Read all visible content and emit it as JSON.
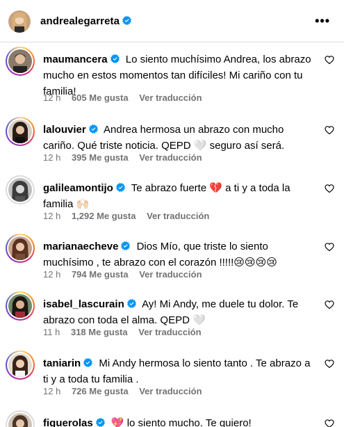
{
  "post": {
    "author": "andrealegarreta"
  },
  "comments": [
    {
      "user": "maumancera",
      "text": "Lo siento muchísimo Andrea, los abrazo mucho en estos momentos tan difíciles! Mi cariño con tu familia!",
      "time": "12 h",
      "likes": "605 Me gusta",
      "translate": "Ver traducción",
      "story_ring": true
    },
    {
      "user": "lalouvier",
      "text": "Andrea hermosa un abrazo con mucho cariño. Qué triste noticia. QEPD 🤍 seguro así será.",
      "time": "12 h",
      "likes": "395 Me gusta",
      "translate": "Ver traducción",
      "story_ring": true
    },
    {
      "user": "galileamontijo",
      "text": "Te abrazo fuerte 💔 a ti y a toda la familia 🙌🏻",
      "time": "12 h",
      "likes": "1,292 Me gusta",
      "translate": "Ver traducción",
      "story_ring": false
    },
    {
      "user": "marianaecheve",
      "text": "Dios Mío, que triste lo siento muchísimo , te abrazo con el corazón !!!!!😢😢😢😢",
      "time": "12 h",
      "likes": "794 Me gusta",
      "translate": "Ver traducción",
      "story_ring": true
    },
    {
      "user": "isabel_lascurain",
      "text": "Ay! Mi Andy, me duele tu dolor. Te abrazo con toda el alma. QEPD 🤍",
      "time": "11 h",
      "likes": "318 Me gusta",
      "translate": "Ver traducción",
      "story_ring": true
    },
    {
      "user": "taniarin",
      "text": "Mi Andy hermosa lo siento tanto . Te abrazo a ti y a toda tu familia .",
      "time": "12 h",
      "likes": "726 Me gusta",
      "translate": "Ver traducción",
      "story_ring": true
    },
    {
      "user": "figuerolas",
      "text": "💖 lo siento mucho. Te quiero!",
      "story_ring": false
    }
  ],
  "colors": {
    "verified": "#0095f6",
    "meta_text": "#737373",
    "divider": "#dbdbdb"
  },
  "icons": {
    "verified": "verified-badge-icon",
    "like": "heart-outline-icon",
    "more": "more-horizontal-icon"
  }
}
